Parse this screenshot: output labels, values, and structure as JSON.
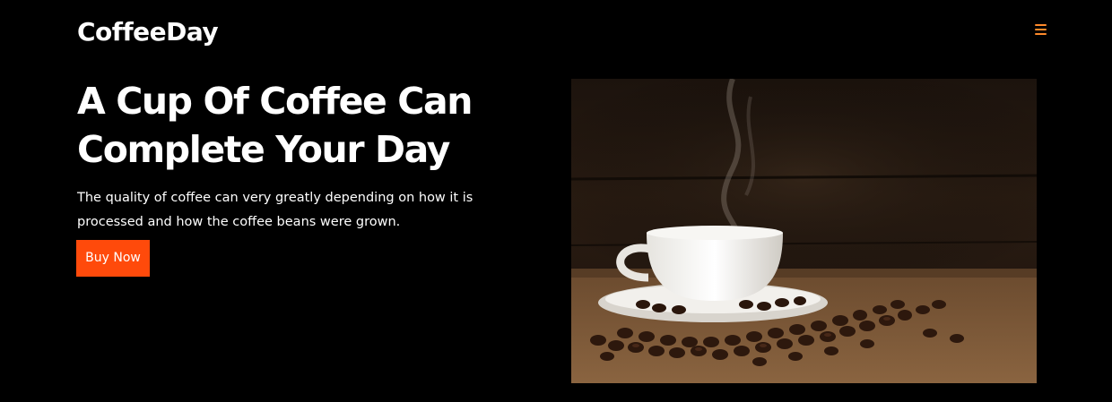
{
  "header": {
    "brand": "CoffeeDay",
    "menu_icon": "hamburger-menu-icon"
  },
  "hero": {
    "title": "A Cup Of Coffee Can Complete Your Day",
    "description": "The quality of coffee can very greatly depending on how it is processed and how the coffee beans were grown.",
    "cta_label": "Buy Now",
    "image_subject": "cup-of-coffee-with-beans"
  },
  "colors": {
    "background": "#000000",
    "accent": "#ff4a0b",
    "menu_icon": "#ff8a2a",
    "text": "#ffffff"
  }
}
